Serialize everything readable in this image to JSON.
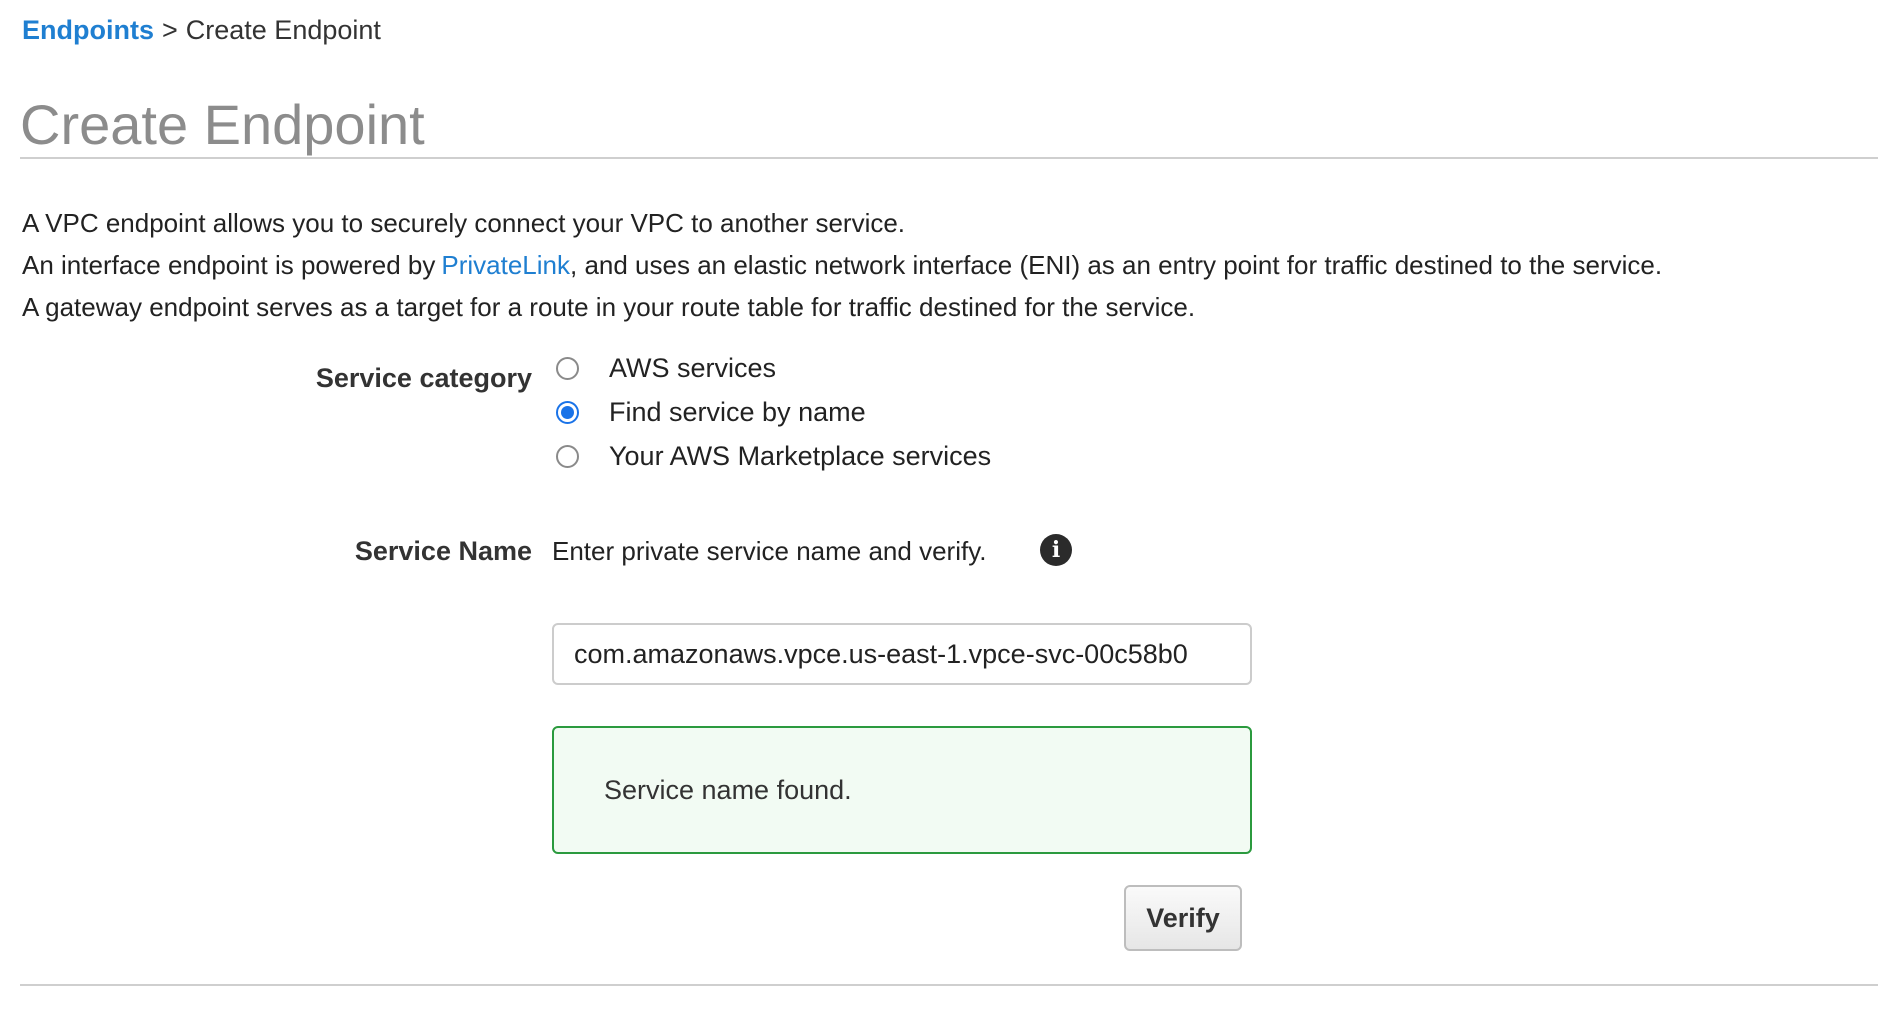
{
  "breadcrumb": {
    "parent": "Endpoints",
    "separator": ">",
    "current": "Create Endpoint"
  },
  "page": {
    "title": "Create Endpoint"
  },
  "description": {
    "line1": "A VPC endpoint allows you to securely connect your VPC to another service.",
    "line2_prefix": "An interface endpoint is powered by",
    "line2_link": "PrivateLink",
    "line2_suffix": ", and uses an elastic network interface (ENI) as an entry point for traffic destined to the service.",
    "line3": "A gateway endpoint serves as a target for a route in your route table for traffic destined for the service."
  },
  "service_category": {
    "label": "Service category",
    "options": [
      {
        "label": "AWS services",
        "selected": false
      },
      {
        "label": "Find service by name",
        "selected": true
      },
      {
        "label": "Your AWS Marketplace services",
        "selected": false
      }
    ]
  },
  "service_name": {
    "label": "Service Name",
    "hint": "Enter private service name and verify.",
    "info_icon": "info-icon",
    "value": "com.amazonaws.vpce.us-east-1.vpce-svc-00c58b0"
  },
  "status": {
    "message": "Service name found.",
    "color": "#2b9a3e"
  },
  "actions": {
    "verify_label": "Verify"
  },
  "colors": {
    "link": "#1f7fd1",
    "radio_selected": "#1a73e8",
    "title": "#8c8c8c",
    "success_bg": "#f2fbf3"
  }
}
